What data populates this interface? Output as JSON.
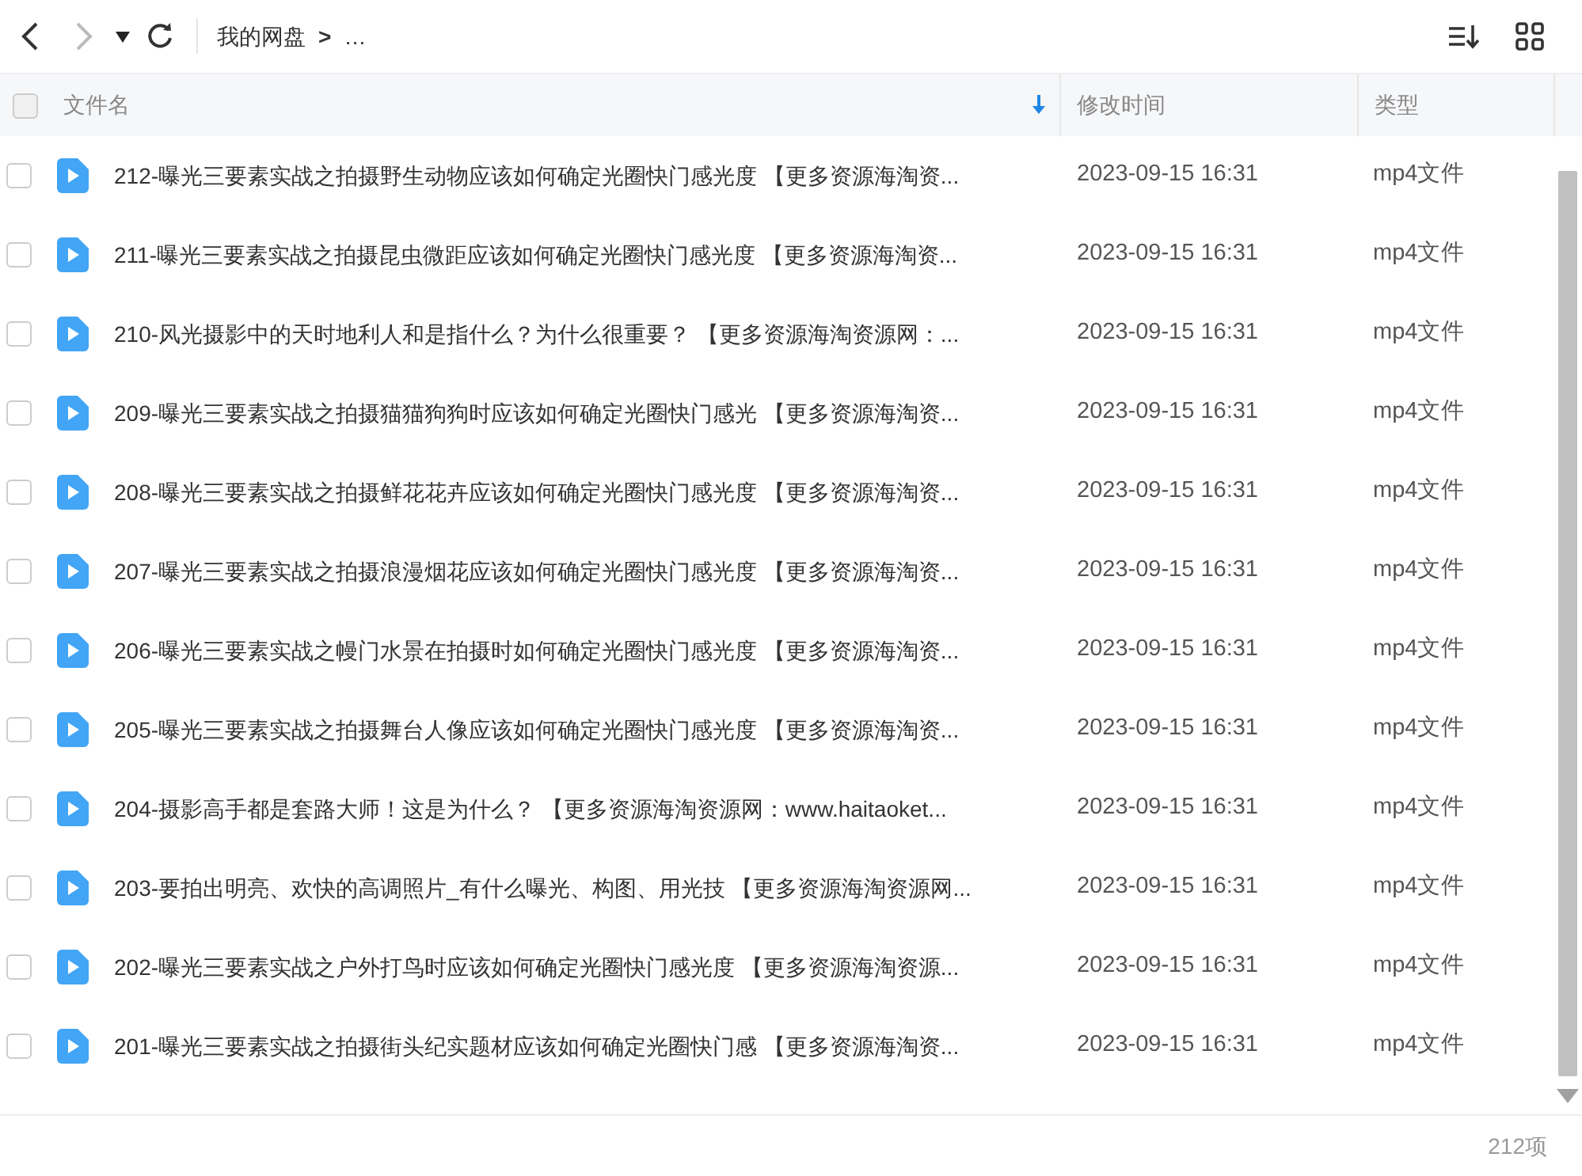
{
  "toolbar": {
    "breadcrumb": [
      "我的网盘",
      "…"
    ],
    "separator": ">"
  },
  "table": {
    "select_all": {
      "checked": false
    },
    "columns": [
      {
        "label": "文件名",
        "sorted": true
      },
      {
        "label": "修改时间",
        "sorted": false
      },
      {
        "label": "类型",
        "sorted": false
      }
    ],
    "rows": [
      {
        "name": "212-曝光三要素实战之拍摄野生动物应该如何确定光圈快门感光度 【更多资源海淘资...",
        "modified": "2023-09-15 16:31",
        "type": "mp4文件",
        "checked": false
      },
      {
        "name": "211-曝光三要素实战之拍摄昆虫微距应该如何确定光圈快门感光度 【更多资源海淘资...",
        "modified": "2023-09-15 16:31",
        "type": "mp4文件",
        "checked": false
      },
      {
        "name": "210-风光摄影中的天时地利人和是指什么？为什么很重要？ 【更多资源海淘资源网：...",
        "modified": "2023-09-15 16:31",
        "type": "mp4文件",
        "checked": false
      },
      {
        "name": "209-曝光三要素实战之拍摄猫猫狗狗时应该如何确定光圈快门感光 【更多资源海淘资...",
        "modified": "2023-09-15 16:31",
        "type": "mp4文件",
        "checked": false
      },
      {
        "name": "208-曝光三要素实战之拍摄鲜花花卉应该如何确定光圈快门感光度 【更多资源海淘资...",
        "modified": "2023-09-15 16:31",
        "type": "mp4文件",
        "checked": false
      },
      {
        "name": "207-曝光三要素实战之拍摄浪漫烟花应该如何确定光圈快门感光度 【更多资源海淘资...",
        "modified": "2023-09-15 16:31",
        "type": "mp4文件",
        "checked": false
      },
      {
        "name": "206-曝光三要素实战之幔门水景在拍摄时如何确定光圈快门感光度 【更多资源海淘资...",
        "modified": "2023-09-15 16:31",
        "type": "mp4文件",
        "checked": false
      },
      {
        "name": "205-曝光三要素实战之拍摄舞台人像应该如何确定光圈快门感光度 【更多资源海淘资...",
        "modified": "2023-09-15 16:31",
        "type": "mp4文件",
        "checked": false
      },
      {
        "name": "204-摄影高手都是套路大师！这是为什么？ 【更多资源海淘资源网：www.haitaoket...",
        "modified": "2023-09-15 16:31",
        "type": "mp4文件",
        "checked": false
      },
      {
        "name": "203-要拍出明亮、欢快的高调照片_有什么曝光、构图、用光技 【更多资源海淘资源网...",
        "modified": "2023-09-15 16:31",
        "type": "mp4文件",
        "checked": false
      },
      {
        "name": "202-曝光三要素实战之户外打鸟时应该如何确定光圈快门感光度 【更多资源海淘资源...",
        "modified": "2023-09-15 16:31",
        "type": "mp4文件",
        "checked": false
      },
      {
        "name": "201-曝光三要素实战之拍摄街头纪实题材应该如何确定光圈快门感 【更多资源海淘资...",
        "modified": "2023-09-15 16:31",
        "type": "mp4文件",
        "checked": false
      }
    ]
  },
  "status_bar": {
    "count": "212项"
  }
}
